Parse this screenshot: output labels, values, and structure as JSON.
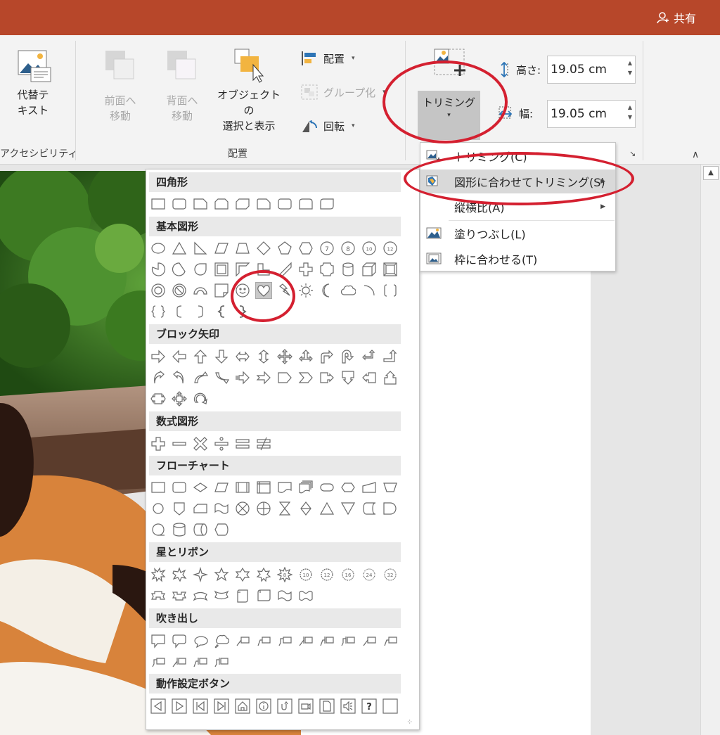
{
  "titlebar": {
    "share_label": "共有"
  },
  "ribbon": {
    "alt_text_label": "代替テ\nキスト",
    "accessibility_group": "アクセシビリティ",
    "bring_forward_label": "前面へ\n移動",
    "send_backward_label": "背面へ\n移動",
    "selection_pane_label": "オブジェクトの\n選択と表示",
    "align_label": "配置",
    "group_label": "グループ化",
    "rotate_label": "回転",
    "arrange_group": "配置",
    "crop_label": "トリミング",
    "height_label": "高さ:",
    "height_value": "19.05 cm",
    "width_label": "幅:",
    "width_value": "19.05 cm"
  },
  "crop_menu": {
    "items": [
      {
        "label": "トリミング(C)"
      },
      {
        "label": "図形に合わせてトリミング(S)"
      },
      {
        "label": "縦横比(A)"
      },
      {
        "label": "塗りつぶし(L)"
      },
      {
        "label": "枠に合わせる(T)"
      }
    ]
  },
  "gallery": {
    "categories": [
      {
        "label": "四角形"
      },
      {
        "label": "基本図形"
      },
      {
        "label": "ブロック矢印"
      },
      {
        "label": "数式図形"
      },
      {
        "label": "フローチャート"
      },
      {
        "label": "星とリボン"
      },
      {
        "label": "吹き出し"
      },
      {
        "label": "動作設定ボタン"
      }
    ],
    "selected_shape": "heart"
  },
  "colors": {
    "titlebar": "#b7472a",
    "annotation": "#d42030",
    "highlight": "#d9d9d9"
  }
}
